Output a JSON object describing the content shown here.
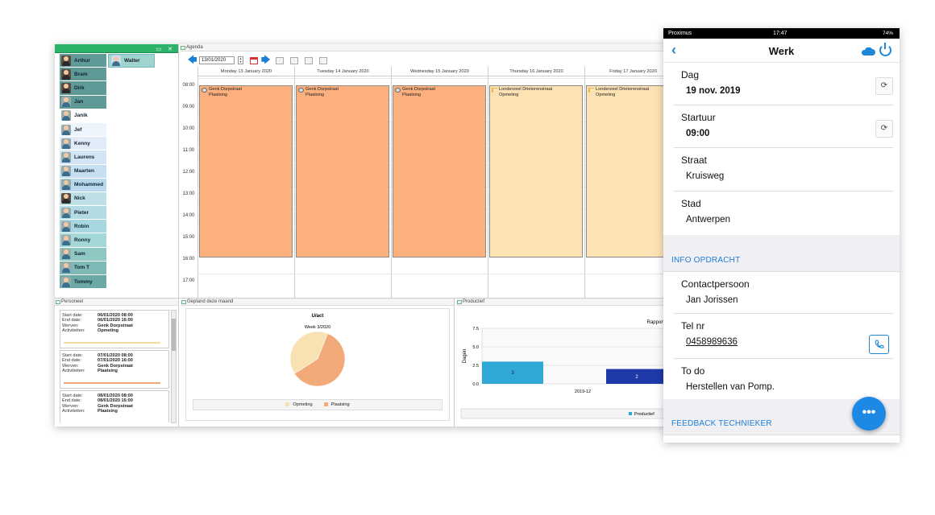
{
  "desktop": {
    "staff_panel_title": "Personeel",
    "agenda_panel_title": "Agenda",
    "staff": [
      {
        "name": "Arthur",
        "color": "#5f9a96",
        "photo": true
      },
      {
        "name": "Bram",
        "color": "#5f9a96",
        "photo": true
      },
      {
        "name": "Dirk",
        "color": "#5f9a96",
        "photo": true
      },
      {
        "name": "Jan",
        "color": "#5f9a96",
        "photo": false
      },
      {
        "name": "Janik",
        "color": "#ffffff",
        "photo": false
      },
      {
        "name": "Jef",
        "color": "#eef4fb",
        "photo": false
      },
      {
        "name": "Kenny",
        "color": "#e1ecf8",
        "photo": false
      },
      {
        "name": "Laurens",
        "color": "#d3e5f5",
        "photo": false
      },
      {
        "name": "Maarten",
        "color": "#c6dff2",
        "photo": false
      },
      {
        "name": "Mohammed",
        "color": "#b8d8ee",
        "photo": false
      },
      {
        "name": "Nick",
        "color": "#bde0e6",
        "photo": true
      },
      {
        "name": "Pieter",
        "color": "#b3dbe4",
        "photo": false
      },
      {
        "name": "Robin",
        "color": "#a8d8df",
        "photo": false
      },
      {
        "name": "Ronny",
        "color": "#a4d8d6",
        "photo": false
      },
      {
        "name": "Sam",
        "color": "#8fc7c2",
        "photo": false
      },
      {
        "name": "Tom T",
        "color": "#7dbab5",
        "photo": false
      },
      {
        "name": "Tommy",
        "color": "#6aa9a4",
        "photo": false
      }
    ],
    "selected_staff": "Walter",
    "agenda": {
      "date_value": "13/01/2020",
      "days": [
        "Monday 13 January 2020",
        "Tuesday 14 January 2020",
        "Wednesday 15 January 2020",
        "Thursday 16 January 2020",
        "Friday 17 January 2020"
      ],
      "hours": [
        "08:00",
        "09:00",
        "10:00",
        "11:00",
        "12:00",
        "13:00",
        "14:00",
        "15:00",
        "16:00",
        "17:00"
      ],
      "events": [
        {
          "day": 0,
          "street": "Genk Dorpstraat",
          "type": "Plaatsing",
          "style": "orange"
        },
        {
          "day": 1,
          "street": "Genk Dorpstraat",
          "type": "Plaatsing",
          "style": "orange"
        },
        {
          "day": 2,
          "street": "Genk Dorpstraat",
          "type": "Plaatsing",
          "style": "orange"
        },
        {
          "day": 3,
          "street": "Londerzeel Drietorenstraat",
          "type": "Opmeting",
          "style": "beige"
        },
        {
          "day": 4,
          "street": "Londerzeel Drietorenstraat",
          "type": "Opmeting",
          "style": "beige"
        }
      ]
    },
    "personeel": {
      "title": "Personeel",
      "labels": {
        "start": "Start date:",
        "end": "End date:",
        "werven": "Werven:",
        "activiteiten": "Activiteiten:"
      },
      "cards": [
        {
          "start": "06/01/2020 08:00",
          "end": "06/01/2020 16:00",
          "werven": "Genk Dorpstraat",
          "activiteiten": "Opmeting",
          "bar": "y"
        },
        {
          "start": "07/01/2020 08:00",
          "end": "07/01/2020 16:00",
          "werven": "Genk Dorpstraat",
          "activiteiten": "Plaatsing",
          "bar": "o"
        },
        {
          "start": "08/01/2020 08:00",
          "end": "08/01/2020 16:00",
          "werven": "Genk Dorpstraat",
          "activiteiten": "Plaatsing",
          "bar": "o"
        }
      ]
    },
    "gepland": {
      "title": "Gepland deze maand",
      "chart_title": "U/act",
      "chart_subtitle": "Week 3/2020"
    },
    "productief": {
      "title": "Productief",
      "chart_title": "Rapport"
    }
  },
  "chart_data": [
    {
      "type": "pie",
      "title": "U/act",
      "subtitle": "Week 3/2020",
      "categories": [
        "Opmeting",
        "Plaatsing"
      ],
      "values": [
        40,
        60
      ],
      "colors": [
        "#f8e2b4",
        "#f3aa7a"
      ],
      "legend": "bottom"
    },
    {
      "type": "bar",
      "title": "Rapport",
      "categories": [
        "2019-12"
      ],
      "series": [
        {
          "name": "Productief",
          "values": [
            3
          ],
          "color": "#2fa8d6"
        },
        {
          "name": "",
          "values": [
            2
          ],
          "color": "#1e3aa8"
        }
      ],
      "ylabel": "Dagen",
      "ylim": [
        0,
        7.5
      ],
      "yticks": [
        0.0,
        2.5,
        5.0,
        7.5
      ],
      "grid": true,
      "legend": "bottom"
    }
  ],
  "mobile": {
    "status_carrier": "Proximus",
    "status_time": "17:47",
    "status_right": "74%",
    "title": "Werk",
    "fields": {
      "dag_label": "Dag",
      "dag_value": "19 nov. 2019",
      "startuur_label": "Startuur",
      "startuur_value": "09:00",
      "straat_label": "Straat",
      "straat_value": "Kruisweg",
      "stad_label": "Stad",
      "stad_value": "Antwerpen",
      "contact_label": "Contactpersoon",
      "contact_value": "Jan Jorissen",
      "tel_label": "Tel nr",
      "tel_value": "0458989636",
      "todo_label": "To do",
      "todo_value": "Herstellen van Pomp."
    },
    "section_info": "INFO OPDRACHT",
    "section_feedback": "FEEDBACK TECHNIEKER",
    "fab_label": "•••",
    "accent": "#1e88e5"
  }
}
